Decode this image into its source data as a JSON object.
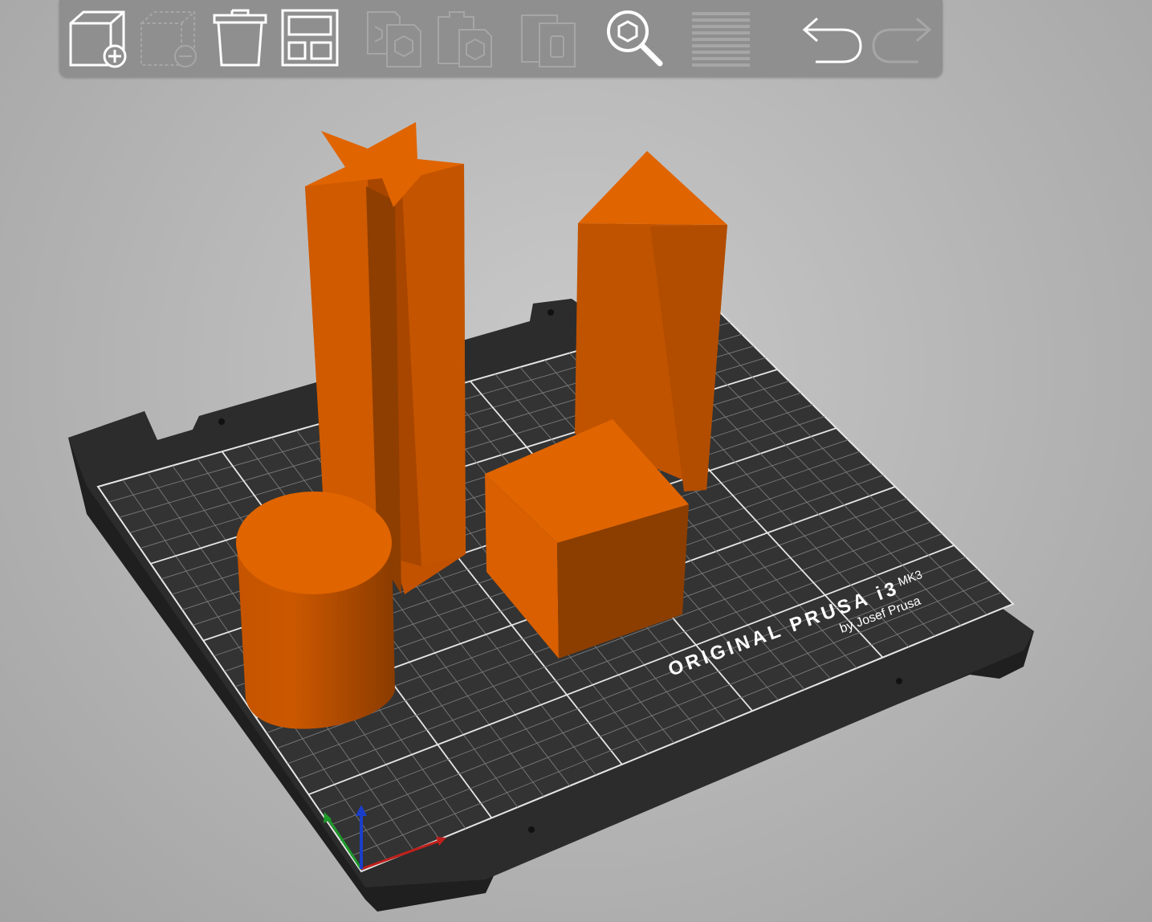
{
  "toolbar": {
    "buttons": [
      {
        "name": "add-object-button",
        "icon": "cube-plus-icon",
        "enabled": true
      },
      {
        "name": "delete-object-button",
        "icon": "cube-minus-icon",
        "enabled": false
      },
      {
        "name": "delete-all-button",
        "icon": "trash-icon",
        "enabled": true
      },
      {
        "name": "arrange-button",
        "icon": "arrange-icon",
        "enabled": true
      },
      {
        "name": "copy-button",
        "icon": "copy-icon",
        "enabled": false
      },
      {
        "name": "paste-button",
        "icon": "paste-icon",
        "enabled": false
      },
      {
        "name": "instances-button",
        "icon": "instances-icon",
        "enabled": false
      },
      {
        "name": "search-button",
        "icon": "search-icon",
        "enabled": true
      },
      {
        "name": "layers-button",
        "icon": "layers-icon",
        "enabled": false
      },
      {
        "name": "undo-button",
        "icon": "undo-icon",
        "enabled": true
      },
      {
        "name": "redo-button",
        "icon": "redo-icon",
        "enabled": false
      }
    ]
  },
  "bed": {
    "brand_line": "ORIGINAL PRUSA i3",
    "model": "MK3",
    "maker": "by Josef Prusa"
  },
  "colors": {
    "model_top": "#e06400",
    "model_side": "#c25200",
    "model_dark": "#8a3d00",
    "bed": "#2b2b2b",
    "bed_edge": "#1e1e1e",
    "grid": "#d9d9d9"
  },
  "objects": [
    {
      "name": "star-prism"
    },
    {
      "name": "triangular-prism"
    },
    {
      "name": "cylinder"
    },
    {
      "name": "cube"
    }
  ]
}
